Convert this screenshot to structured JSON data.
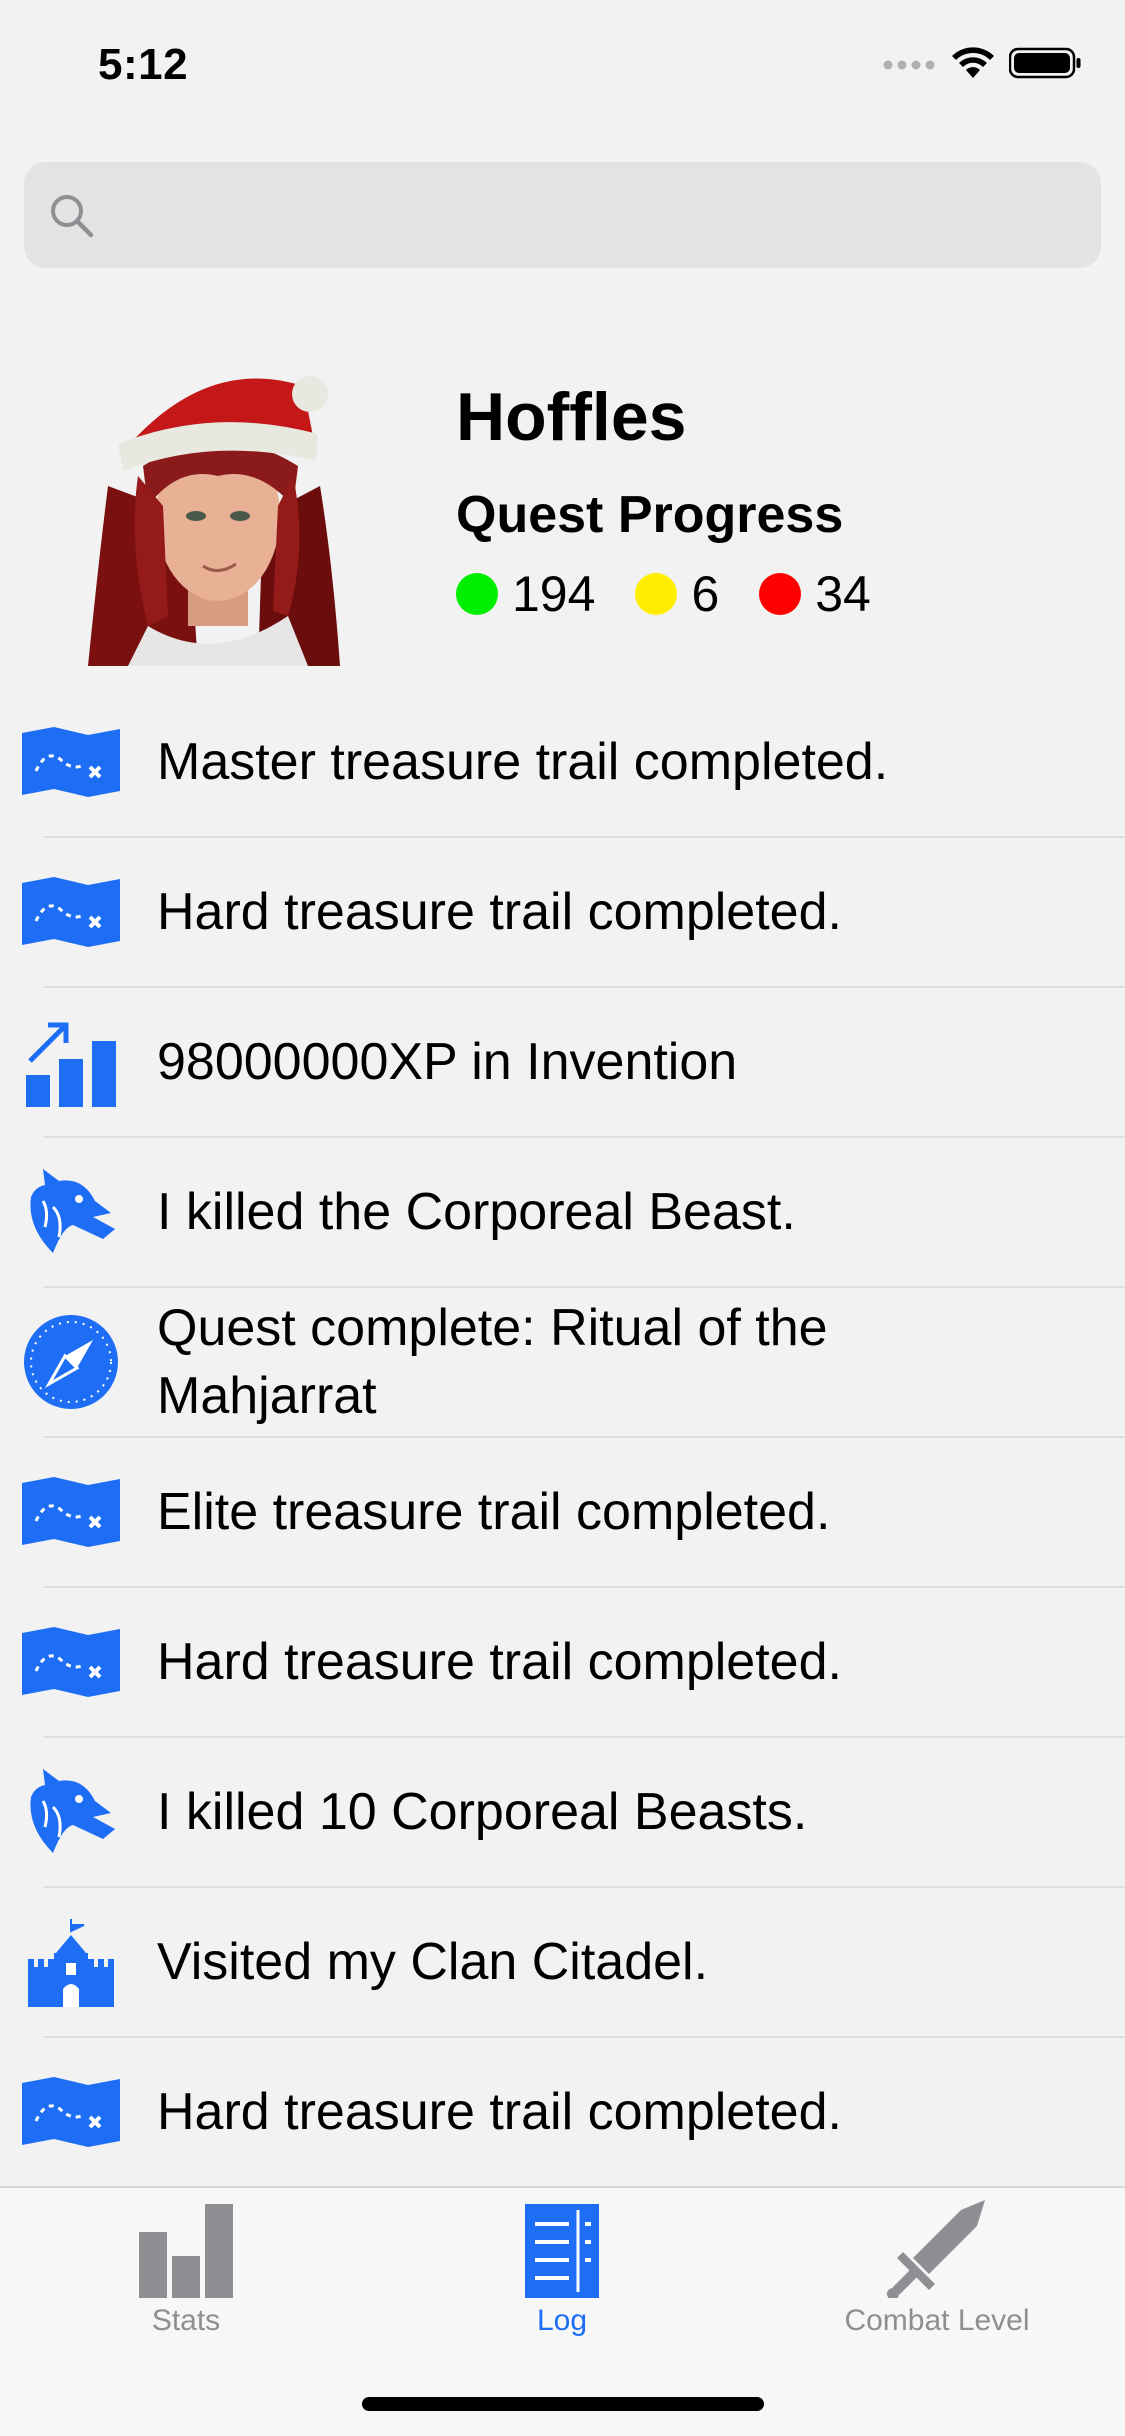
{
  "status": {
    "time": "5:12"
  },
  "search": {
    "placeholder": ""
  },
  "profile": {
    "name": "Hoffles",
    "quest_title": "Quest Progress",
    "quests": [
      {
        "color": "#00ff00",
        "count": "194"
      },
      {
        "color": "#ffee00",
        "count": "6"
      },
      {
        "color": "#ff0000",
        "count": "34"
      }
    ]
  },
  "log": [
    {
      "icon": "treasure-map-icon",
      "text": "Master treasure trail completed."
    },
    {
      "icon": "treasure-map-icon",
      "text": "Hard treasure trail completed."
    },
    {
      "icon": "xp-chart-icon",
      "text": "98000000XP in Invention"
    },
    {
      "icon": "dragon-icon",
      "text": "I killed  the Corporeal Beast."
    },
    {
      "icon": "compass-icon",
      "text": "Quest complete: Ritual of the Mahjarrat"
    },
    {
      "icon": "treasure-map-icon",
      "text": "Elite treasure trail completed."
    },
    {
      "icon": "treasure-map-icon",
      "text": "Hard treasure trail completed."
    },
    {
      "icon": "dragon-icon",
      "text": "I killed 10 Corporeal Beasts."
    },
    {
      "icon": "castle-icon",
      "text": "Visited my Clan Citadel."
    },
    {
      "icon": "treasure-map-icon",
      "text": "Hard treasure trail completed."
    }
  ],
  "tabs": [
    {
      "label": "Stats",
      "icon": "bar-chart-icon",
      "active": false
    },
    {
      "label": "Log",
      "icon": "log-book-icon",
      "active": true
    },
    {
      "label": "Combat Level",
      "icon": "sword-icon",
      "active": false
    }
  ],
  "colors": {
    "accent": "#1d6ef5",
    "inactive": "#8e8e93"
  }
}
